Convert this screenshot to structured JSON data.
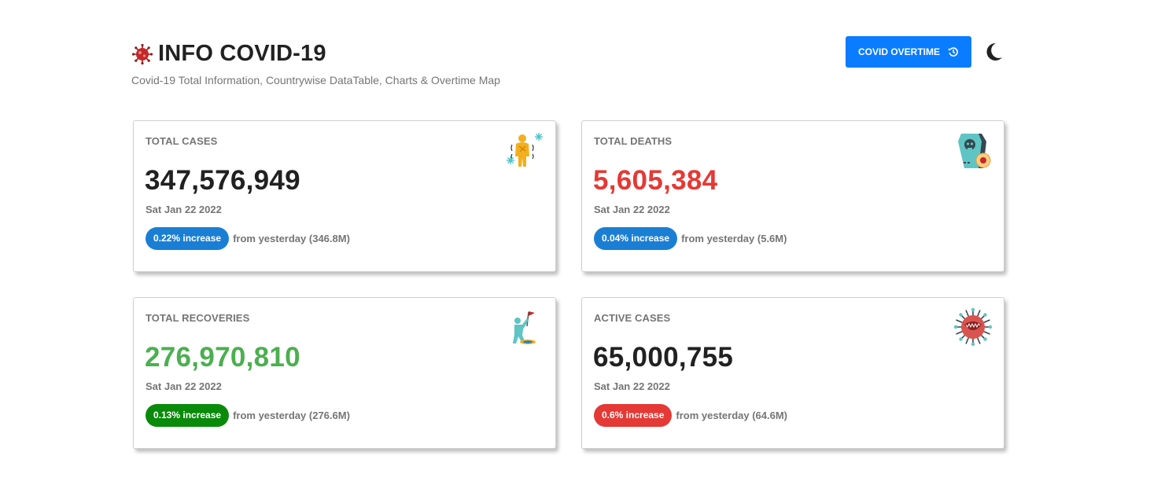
{
  "header": {
    "title": "INFO COVID-19",
    "subtitle": "Covid-19 Total Information, Countrywise DataTable, Charts & Overtime Map",
    "overtime_button": "COVID OVERTIME",
    "title_icon": "virus-icon",
    "button_icon": "history-icon",
    "theme_icon": "moon-icon"
  },
  "colors": {
    "primary": "#0a7cff",
    "danger": "#e53935",
    "success": "#4caf50",
    "pill_blue": "#1a7fd4",
    "pill_green": "#0a8a0a",
    "pill_red": "#e53935",
    "text_dark": "#212121",
    "text_muted": "#757575"
  },
  "cards": [
    {
      "label": "TOTAL CASES",
      "value": "347,576,949",
      "date": "Sat Jan 22 2022",
      "pill": "0.22% increase",
      "change": "from yesterday (346.8M)",
      "icon": "sick-person-icon"
    },
    {
      "label": "TOTAL DEATHS",
      "value": "5,605,384",
      "date": "Sat Jan 22 2022",
      "pill": "0.04% increase",
      "change": "from yesterday (5.6M)",
      "icon": "coffin-icon"
    },
    {
      "label": "TOTAL RECOVERIES",
      "value": "276,970,810",
      "date": "Sat Jan 22 2022",
      "pill": "0.13% increase",
      "change": "from yesterday (276.6M)",
      "icon": "victory-flag-icon"
    },
    {
      "label": "ACTIVE CASES",
      "value": "65,000,755",
      "date": "Sat Jan 22 2022",
      "pill": "0.6% increase",
      "change": "from yesterday (64.6M)",
      "icon": "virus-icon"
    }
  ]
}
